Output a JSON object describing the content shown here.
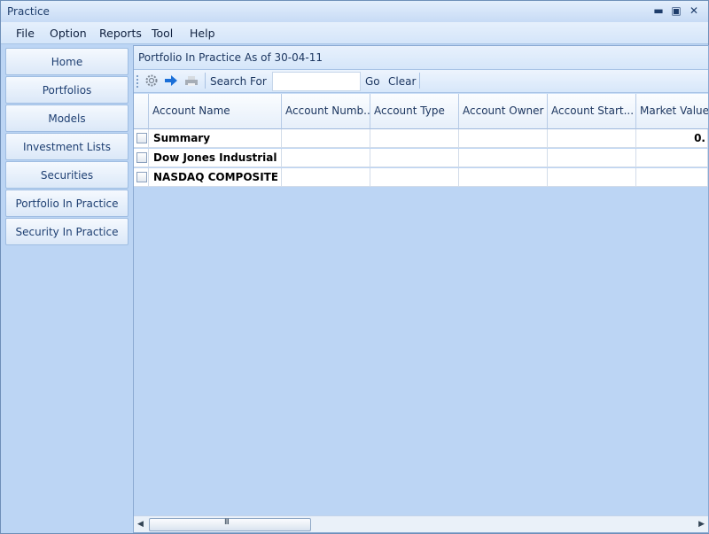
{
  "window": {
    "title": "Practice"
  },
  "menu": [
    "File",
    "Option",
    "Reports",
    "Tool",
    "Help"
  ],
  "sidebar": {
    "items": [
      {
        "label": "Home"
      },
      {
        "label": "Portfolios"
      },
      {
        "label": "Models"
      },
      {
        "label": "Investment Lists"
      },
      {
        "label": "Securities"
      },
      {
        "label": "Portfolio In Practice"
      },
      {
        "label": "Security In Practice"
      }
    ]
  },
  "main": {
    "header": "Portfolio In Practice As of 30-04-11"
  },
  "toolbar": {
    "icons": [
      "settings-icon",
      "forward-arrow-icon",
      "print-icon"
    ],
    "search_label": "Search For",
    "search_value": "",
    "go_label": "Go",
    "clear_label": "Clear"
  },
  "grid": {
    "columns": [
      "Account Name",
      "Account Numb...",
      "Account Type",
      "Account Owner",
      "Account  Start...",
      "Market Value"
    ],
    "rows": [
      {
        "cells": [
          "Summary",
          "",
          "",
          "",
          "",
          "0."
        ]
      },
      {
        "cells": [
          "Dow Jones Industrial ...",
          "",
          "",
          "",
          "",
          ""
        ]
      },
      {
        "cells": [
          "NASDAQ COMPOSITE",
          "",
          "",
          "",
          "",
          ""
        ]
      }
    ]
  },
  "scrollbar": {
    "thumb_grip": "III"
  },
  "colors": {
    "accent": "#1e3f72",
    "panel": "#bcd5f4",
    "border": "#8aa9d1"
  }
}
